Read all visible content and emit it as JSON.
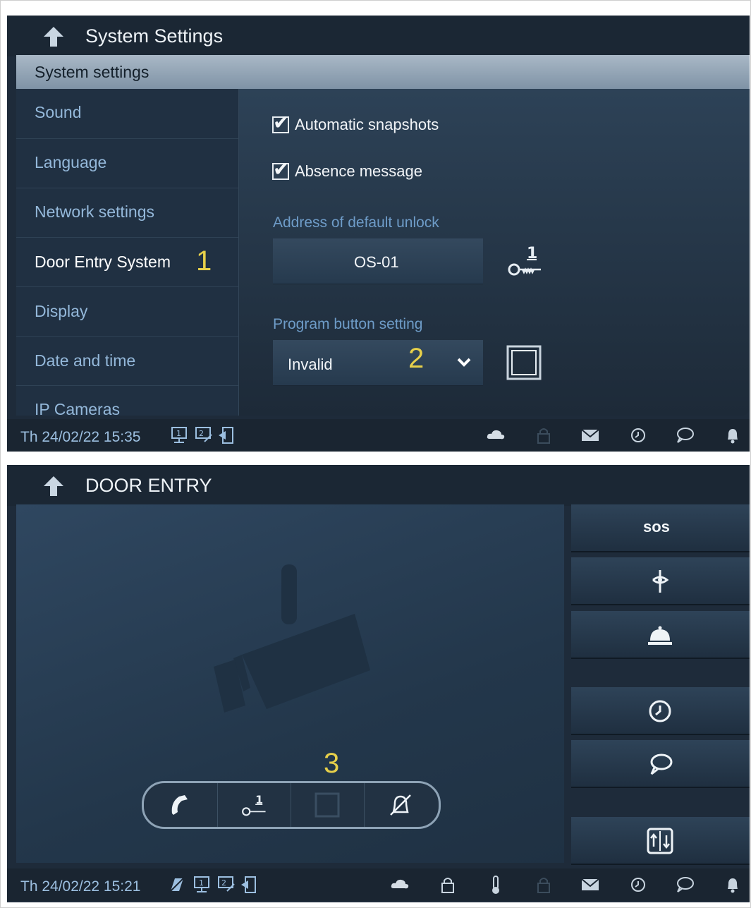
{
  "panel1": {
    "title": "System Settings",
    "subheader": "System settings",
    "menu": [
      {
        "label": "Sound"
      },
      {
        "label": "Language"
      },
      {
        "label": "Network settings"
      },
      {
        "label": "Door Entry System"
      },
      {
        "label": "Display"
      },
      {
        "label": "Date and time"
      },
      {
        "label": "IP Cameras"
      }
    ],
    "checkboxes": [
      {
        "label": "Automatic snapshots",
        "checked": true
      },
      {
        "label": "Absence message",
        "checked": true
      }
    ],
    "default_unlock_label": "Address of default unlock",
    "default_unlock_value": "OS-01",
    "program_button_label": "Program button setting",
    "program_button_value": "Invalid",
    "markers": {
      "m1": "1",
      "m2": "2"
    },
    "status_datetime": "Th 24/02/22  15:35"
  },
  "panel2": {
    "title": "DOOR ENTRY",
    "sos_label": "sos",
    "marker3": "3",
    "status_datetime": "Th 24/02/22  15:21"
  },
  "colors": {
    "background": "#1e2b3a",
    "menu_text": "#94b8da",
    "marker": "#e7d04a",
    "field_label": "#6e9cc8"
  },
  "icons": [
    "back-arrow-icon",
    "unlock-key-1-icon",
    "program-button-icon",
    "cloud-icon",
    "lock-icon",
    "mail-icon",
    "history-icon",
    "chat-icon",
    "bell-icon",
    "thermometer-icon",
    "sos-icon",
    "fan-icon",
    "doorbell-icon",
    "elevator-icon",
    "phone-icon",
    "mute-icon",
    "camera-placeholder-icon"
  ]
}
